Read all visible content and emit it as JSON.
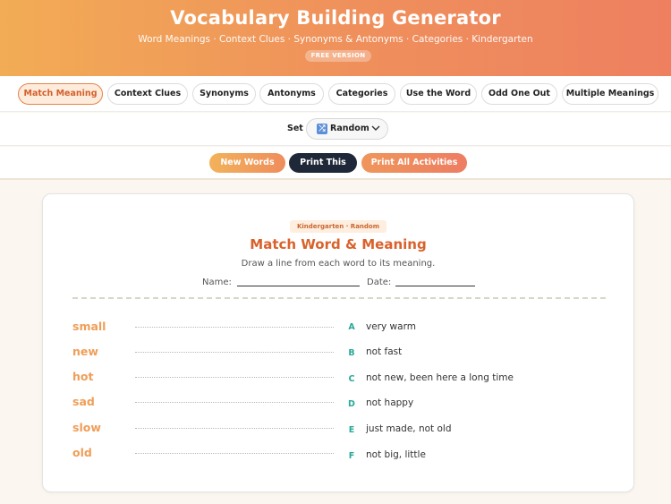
{
  "header": {
    "title": "Vocabulary Building Generator",
    "subtitle": "Word Meanings · Context Clues · Synonyms & Antonyms · Categories · Kindergarten",
    "badge": "FREE VERSION"
  },
  "tabs": [
    {
      "label": "Match Meaning",
      "active": true
    },
    {
      "label": "Context Clues",
      "active": false
    },
    {
      "label": "Synonyms",
      "active": false
    },
    {
      "label": "Antonyms",
      "active": false
    },
    {
      "label": "Categories",
      "active": false
    },
    {
      "label": "Use the Word",
      "active": false
    },
    {
      "label": "Odd One Out",
      "active": false
    },
    {
      "label": "Multiple Meanings",
      "active": false
    }
  ],
  "set_selector": {
    "label": "Set",
    "value": "Random",
    "icon": "shuffle-icon"
  },
  "actions": {
    "new_words": "New Words",
    "print": "Print This",
    "print_all": "Print All Activities"
  },
  "worksheet": {
    "badge": "Kindergarten · Random",
    "title": "Match Word & Meaning",
    "instructions": "Draw a line from each word to its meaning.",
    "name_label": "Name:",
    "date_label": "Date:",
    "words": [
      "small",
      "new",
      "hot",
      "sad",
      "slow",
      "old"
    ],
    "meanings": [
      {
        "letter": "A",
        "text": "very warm"
      },
      {
        "letter": "B",
        "text": "not fast"
      },
      {
        "letter": "C",
        "text": "not new, been here a long time"
      },
      {
        "letter": "D",
        "text": "not happy"
      },
      {
        "letter": "E",
        "text": "just made, not old"
      },
      {
        "letter": "F",
        "text": "not big, little"
      }
    ]
  },
  "colors": {
    "accent": "#d9622c",
    "word": "#ef9e58",
    "letter": "#2aa89a",
    "dark_button": "#1f2838"
  }
}
